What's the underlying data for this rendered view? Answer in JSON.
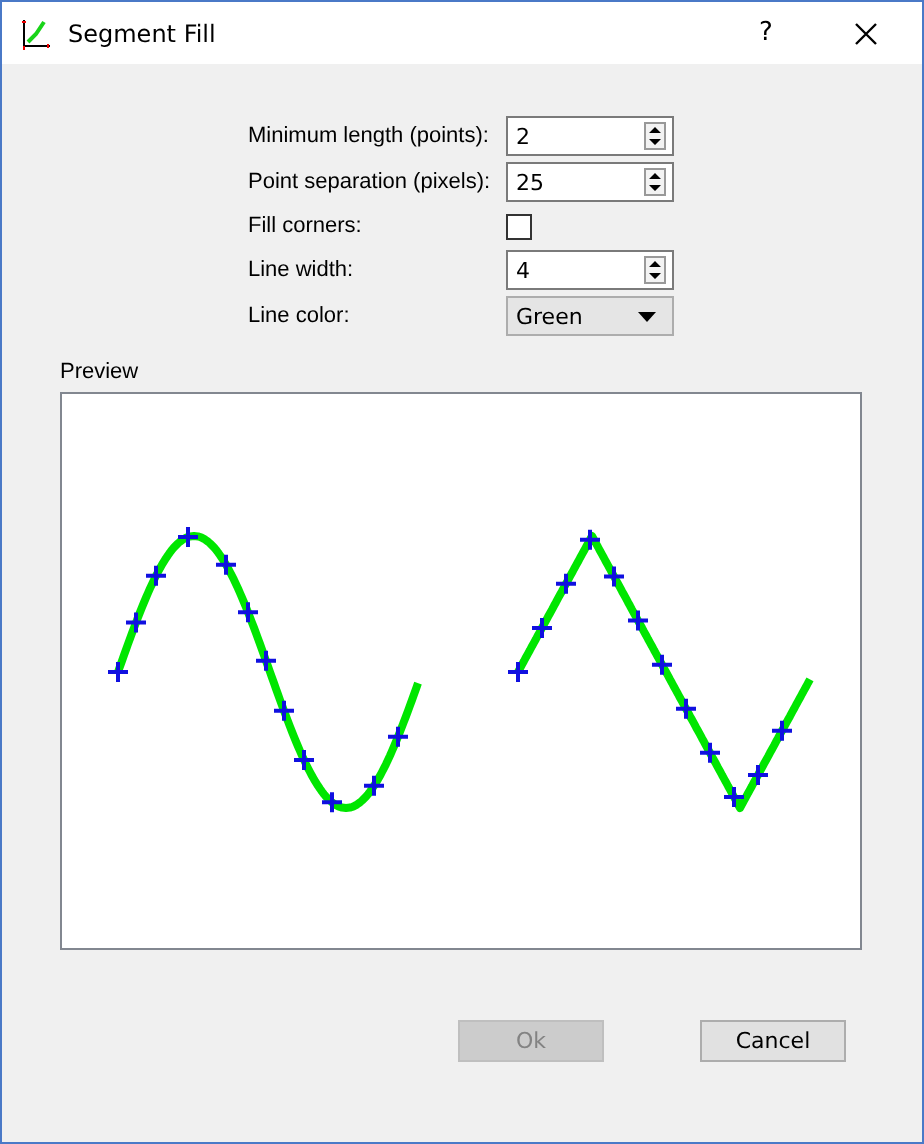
{
  "window": {
    "title": "Segment Fill",
    "help": "?"
  },
  "fields": [
    {
      "kind": "spin",
      "label": "Minimum length (points):",
      "value": "2"
    },
    {
      "kind": "spin",
      "label": "Point separation (pixels):",
      "value": "25"
    },
    {
      "kind": "checkbox",
      "label": "Fill corners:",
      "checked": false
    },
    {
      "kind": "spin",
      "label": "Line width:",
      "value": "4"
    },
    {
      "kind": "select",
      "label": "Line color:",
      "value": "Green"
    }
  ],
  "preview": {
    "label": "Preview"
  },
  "buttons": [
    {
      "label": "Ok",
      "disabled": true
    },
    {
      "label": "Cancel",
      "disabled": false
    }
  ]
}
